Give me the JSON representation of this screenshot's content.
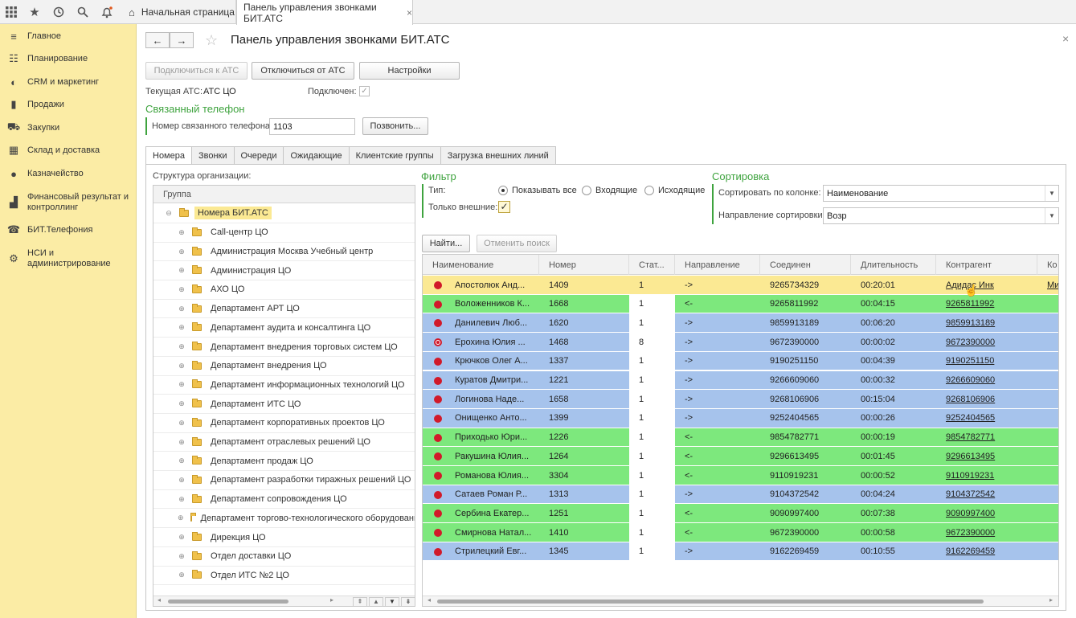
{
  "topbar": {
    "icons": [
      "grid-icon",
      "star-icon",
      "history-icon",
      "search-icon",
      "bell-icon"
    ],
    "home_tab": "Начальная страница",
    "active_tab": "Панель управления звонками БИТ.АТС",
    "close_glyph": "×"
  },
  "sidebar": {
    "items": [
      {
        "icon": "menu-icon",
        "label": "Главное"
      },
      {
        "icon": "calendar-icon",
        "label": "Планирование"
      },
      {
        "icon": "crm-icon",
        "label": "CRM и маркетинг"
      },
      {
        "icon": "bag-icon",
        "label": "Продажи"
      },
      {
        "icon": "cart-icon",
        "label": "Закупки"
      },
      {
        "icon": "warehouse-icon",
        "label": "Склад и доставка"
      },
      {
        "icon": "coin-icon",
        "label": "Казначейство"
      },
      {
        "icon": "chart-icon",
        "label": "Финансовый результат и контроллинг"
      },
      {
        "icon": "phone-icon",
        "label": "БИТ.Телефония"
      },
      {
        "icon": "gear-icon",
        "label": "НСИ и администрирование"
      }
    ]
  },
  "header": {
    "back": "←",
    "forward": "→",
    "title": "Панель управления звонками БИТ.АТС",
    "close": "×"
  },
  "toolbar": {
    "connect": "Подключиться к АТС",
    "disconnect": "Отключиться от АТС",
    "settings": "Настройки"
  },
  "status": {
    "current_ats_label": "Текущая АТС:",
    "current_ats_value": "АТС ЦО",
    "connected_label": "Подключен:",
    "connected": true
  },
  "linked_phone": {
    "heading": "Связанный телефон",
    "label": "Номер связанного телефона:",
    "value": "1103",
    "call_button": "Позвонить..."
  },
  "tabs": [
    "Номера",
    "Звонки",
    "Очереди",
    "Ожидающие",
    "Клиентские группы",
    "Загрузка внешних линий"
  ],
  "org": {
    "label": "Структура организации:",
    "column": "Группа",
    "root": "Номера БИТ.АТС",
    "expand_glyph": "⊕",
    "collapse_glyph": "⊖",
    "items": [
      "Call-центр ЦО",
      "Администрация Москва Учебный центр",
      "Администрация ЦО",
      "АХО ЦО",
      "Департамент АРТ ЦО",
      "Департамент аудита и консалтинга ЦО",
      "Департамент внедрения торговых систем ЦО",
      "Департамент внедрения ЦО",
      "Департамент информационных технологий ЦО",
      "Департамент ИТС ЦО",
      "Департамент корпоративных проектов ЦО",
      "Департамент отраслевых решений ЦО",
      "Департамент продаж ЦО",
      "Департамент разработки тиражных решений ЦО",
      "Департамент сопровождения ЦО",
      "Департамент торгово-технологического оборудования ЦО",
      "Дирекция ЦО",
      "Отдел доставки ЦО",
      "Отдел ИТС №2 ЦО"
    ]
  },
  "filter": {
    "heading": "Фильтр",
    "type_label": "Тип:",
    "options": [
      "Показывать все",
      "Входящие",
      "Исходящие"
    ],
    "selected": 0,
    "external_only_label": "Только внешние:",
    "external_only": true
  },
  "sort": {
    "heading": "Сортировка",
    "column_label": "Сортировать по колонке:",
    "column_value": "Наименование",
    "direction_label": "Направление сортировки:",
    "direction_value": "Возр"
  },
  "search": {
    "find": "Найти...",
    "cancel": "Отменить поиск"
  },
  "colors": {
    "highlight": "#fbe993",
    "incoming": "#7de87d",
    "outgoing": "#a6c3ec",
    "accent_green": "#3ea33e"
  },
  "table": {
    "columns": [
      "Наименование",
      "Номер",
      "Стат...",
      "Направление",
      "Соединен",
      "Длительность",
      "Контрагент",
      "Ко"
    ],
    "rows": [
      {
        "name": "Апостолюк Анд...",
        "number": "1409",
        "status": "1",
        "direction": "->",
        "connected": "9265734329",
        "duration": "00:20:01",
        "contractor": "Адидас Инк",
        "extra": "Ми",
        "kind": "highlight",
        "ring": false
      },
      {
        "name": "Воложенников К...",
        "number": "1668",
        "status": "1",
        "direction": "<-",
        "connected": "9265811992",
        "duration": "00:04:15",
        "contractor": "9265811992",
        "extra": "",
        "kind": "incoming",
        "ring": false
      },
      {
        "name": "Данилевич Люб...",
        "number": "1620",
        "status": "1",
        "direction": "->",
        "connected": "9859913189",
        "duration": "00:06:20",
        "contractor": "9859913189",
        "extra": "",
        "kind": "outgoing",
        "ring": false
      },
      {
        "name": "Ерохина Юлия ...",
        "number": "1468",
        "status": "8",
        "direction": "->",
        "connected": "9672390000",
        "duration": "00:00:02",
        "contractor": "9672390000",
        "extra": "",
        "kind": "outgoing",
        "ring": true
      },
      {
        "name": "Крючков Олег А...",
        "number": "1337",
        "status": "1",
        "direction": "->",
        "connected": "9190251150",
        "duration": "00:04:39",
        "contractor": "9190251150",
        "extra": "",
        "kind": "outgoing",
        "ring": false
      },
      {
        "name": "Куратов Дмитри...",
        "number": "1221",
        "status": "1",
        "direction": "->",
        "connected": "9266609060",
        "duration": "00:00:32",
        "contractor": "9266609060",
        "extra": "",
        "kind": "outgoing",
        "ring": false
      },
      {
        "name": "Логинова Наде...",
        "number": "1658",
        "status": "1",
        "direction": "->",
        "connected": "9268106906",
        "duration": "00:15:04",
        "contractor": "9268106906",
        "extra": "",
        "kind": "outgoing",
        "ring": false
      },
      {
        "name": "Онищенко Анто...",
        "number": "1399",
        "status": "1",
        "direction": "->",
        "connected": "9252404565",
        "duration": "00:00:26",
        "contractor": "9252404565",
        "extra": "",
        "kind": "outgoing",
        "ring": false
      },
      {
        "name": "Приходько Юри...",
        "number": "1226",
        "status": "1",
        "direction": "<-",
        "connected": "9854782771",
        "duration": "00:00:19",
        "contractor": "9854782771",
        "extra": "",
        "kind": "incoming",
        "ring": false
      },
      {
        "name": "Ракушина Юлия...",
        "number": "1264",
        "status": "1",
        "direction": "<-",
        "connected": "9296613495",
        "duration": "00:01:45",
        "contractor": "9296613495",
        "extra": "",
        "kind": "incoming",
        "ring": false
      },
      {
        "name": "Романова Юлия...",
        "number": "3304",
        "status": "1",
        "direction": "<-",
        "connected": "9110919231",
        "duration": "00:00:52",
        "contractor": "9110919231",
        "extra": "",
        "kind": "incoming",
        "ring": false
      },
      {
        "name": "Сатаев Роман Р...",
        "number": "1313",
        "status": "1",
        "direction": "->",
        "connected": "9104372542",
        "duration": "00:04:24",
        "contractor": "9104372542",
        "extra": "",
        "kind": "outgoing",
        "ring": false
      },
      {
        "name": "Сербина Екатер...",
        "number": "1251",
        "status": "1",
        "direction": "<-",
        "connected": "9090997400",
        "duration": "00:07:38",
        "contractor": "9090997400",
        "extra": "",
        "kind": "incoming",
        "ring": false
      },
      {
        "name": "Смирнова Натал...",
        "number": "1410",
        "status": "1",
        "direction": "<-",
        "connected": "9672390000",
        "duration": "00:00:58",
        "contractor": "9672390000",
        "extra": "",
        "kind": "incoming",
        "ring": false
      },
      {
        "name": "Стрилецкий Евг...",
        "number": "1345",
        "status": "1",
        "direction": "->",
        "connected": "9162269459",
        "duration": "00:10:55",
        "contractor": "9162269459",
        "extra": "",
        "kind": "outgoing",
        "ring": false
      }
    ]
  }
}
